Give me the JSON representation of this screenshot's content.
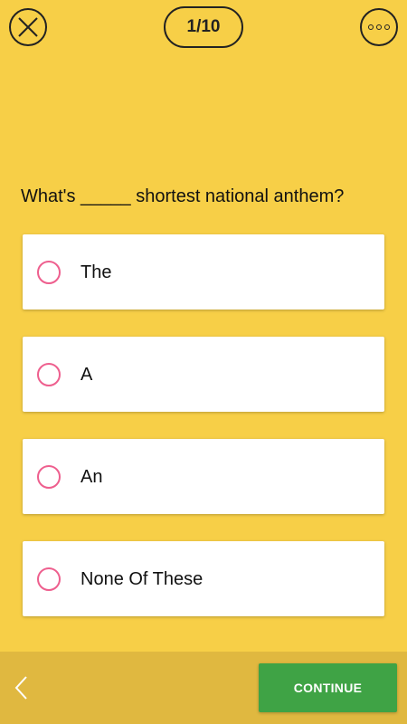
{
  "header": {
    "progress": "1/10",
    "close_icon": "close-icon",
    "more_icon": "more-options-icon"
  },
  "question": "What's _____ shortest national anthem?",
  "options": [
    {
      "label": "The"
    },
    {
      "label": "A"
    },
    {
      "label": "An"
    },
    {
      "label": "None Of These"
    }
  ],
  "footer": {
    "back_icon": "chevron-left-icon",
    "continue_label": "CONTINUE"
  },
  "colors": {
    "background": "#f7cf47",
    "footer": "#e0b840",
    "radio": "#ee5f8e",
    "continue": "#3fa345"
  }
}
